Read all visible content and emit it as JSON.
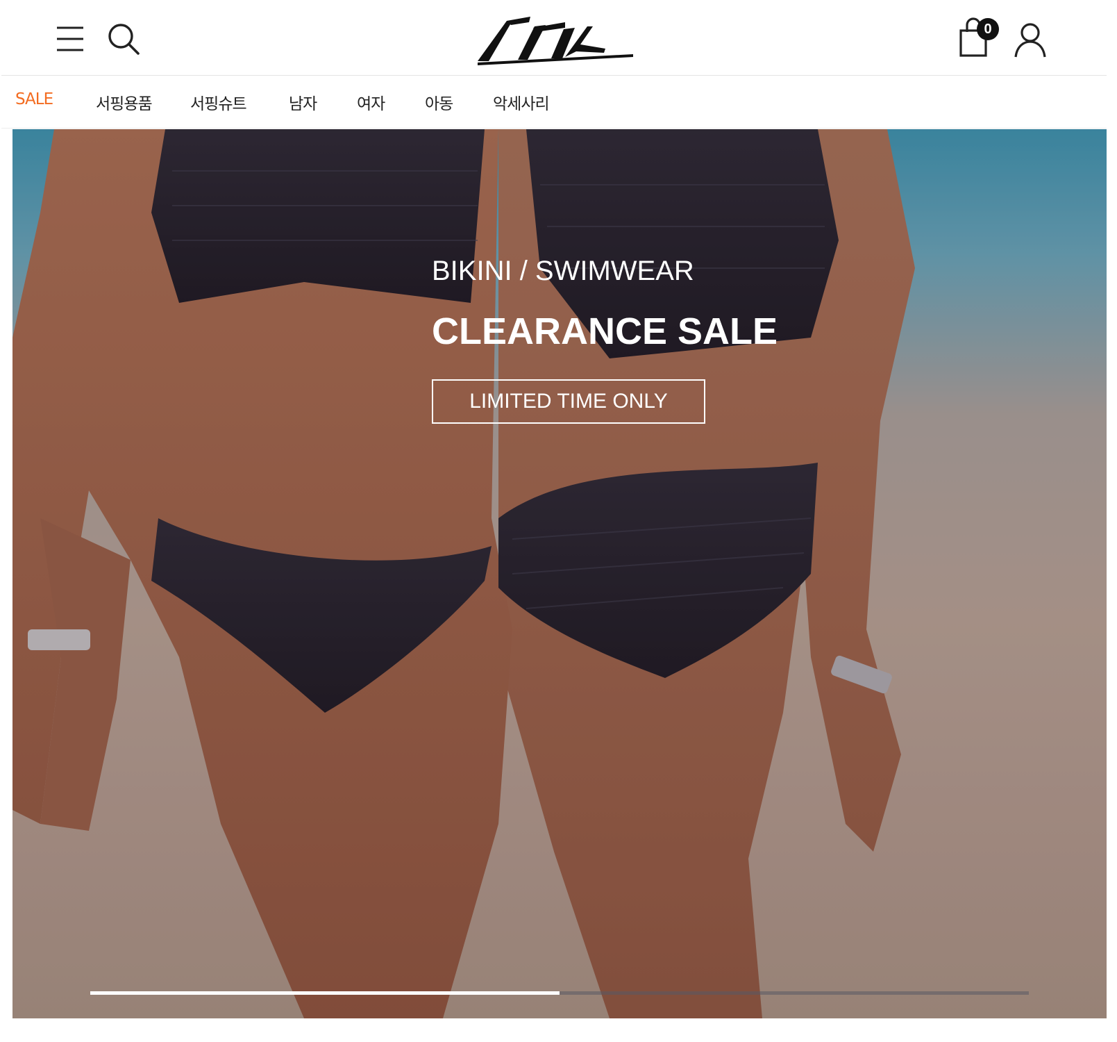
{
  "header": {
    "menu_icon": "hamburger-menu-icon",
    "search_icon": "search-icon",
    "logo_icon": "brand-logo",
    "cart_icon": "shopping-bag-icon",
    "cart_count": "0",
    "user_icon": "user-account-icon"
  },
  "nav": {
    "items": [
      {
        "label": "SALE",
        "highlight": true
      },
      {
        "label": "서핑용품"
      },
      {
        "label": "서핑슈트"
      },
      {
        "label": "남자"
      },
      {
        "label": "여자"
      },
      {
        "label": "아동"
      },
      {
        "label": "악세사리"
      }
    ]
  },
  "hero": {
    "kicker": "BIKINI / SWIMWEAR",
    "title": "CLEARANCE SALE",
    "cta_label": "LIMITED TIME ONLY",
    "slider_progress": 0.5
  },
  "colors": {
    "sale_accent": "#f36c21",
    "text": "#222222",
    "badge": "#111111"
  }
}
